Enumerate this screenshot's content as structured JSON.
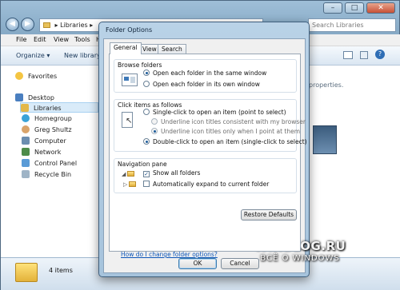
{
  "explorer": {
    "breadcrumb": "Libraries",
    "search_placeholder": "Search Libraries",
    "menu": [
      "File",
      "Edit",
      "View",
      "Tools",
      "H"
    ],
    "commands": {
      "organize": "Organize ▾",
      "new_library": "New library"
    },
    "nav": {
      "favorites": "Favorites",
      "desktop": "Desktop",
      "libraries": "Libraries",
      "homegroup": "Homegroup",
      "user": "Greg Shultz",
      "computer": "Computer",
      "network": "Network",
      "control_panel": "Control Panel",
      "recycle_bin": "Recycle Bin"
    },
    "background_text": "properties.",
    "status": "4 items"
  },
  "dialog": {
    "title": "Folder Options",
    "tabs": [
      "General",
      "View",
      "Search"
    ],
    "browse": {
      "title": "Browse folders",
      "opt_same": "Open each folder in the same window",
      "opt_own": "Open each folder in its own window",
      "selected": "same"
    },
    "click": {
      "title": "Click items as follows",
      "opt_single": "Single-click to open an item (point to select)",
      "opt_under_consistent": "Underline icon titles consistent with my browser",
      "opt_under_point": "Underline icon titles only when I point at them",
      "opt_double": "Double-click to open an item (single-click to select)",
      "selected": "double"
    },
    "navpane": {
      "title": "Navigation pane",
      "show_all": "Show all folders",
      "show_all_checked": true,
      "auto_expand": "Automatically expand to current folder",
      "auto_expand_checked": false
    },
    "restore_label": "Restore Defaults",
    "help_link": "How do I change folder options?",
    "ok_label": "OK",
    "cancel_label": "Cancel"
  },
  "watermark": {
    "line1": "WINBLOG.RU",
    "line2": "ВСЁ О WINDOWS"
  },
  "icons": {
    "back": "back-arrow-icon",
    "forward": "forward-arrow-icon",
    "folder": "folder-icon",
    "star": "star-icon",
    "desktop": "desktop-icon",
    "library": "library-icon",
    "homegroup": "homegroup-icon",
    "user": "user-icon",
    "computer": "computer-icon",
    "network": "network-icon",
    "control_panel": "control-panel-icon",
    "recycle_bin": "recycle-bin-icon"
  }
}
